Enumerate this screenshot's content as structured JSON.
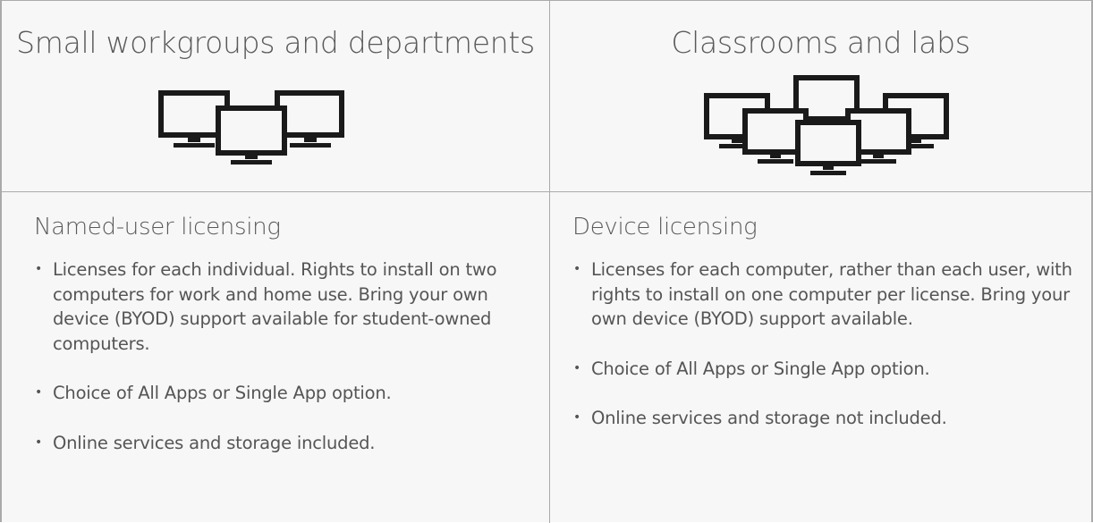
{
  "columns": [
    {
      "heading": "Small workgroups and departments",
      "icon": "computer-group-icon",
      "subheading": "Named-user licensing",
      "bullets": [
        "Licenses for each individual. Rights to install on two computers for work and home use. Bring your own device (BYOD) support available for student-owned computers.",
        "Choice of All Apps or Single App option.",
        "Online services and storage included."
      ]
    },
    {
      "heading": "Classrooms and labs",
      "icon": "computer-lab-icon",
      "subheading": "Device licensing",
      "bullets": [
        "Licenses for each computer, rather than each user, with rights to install on one computer per license. Bring your own device (BYOD) support available.",
        "Choice of All Apps or Single App option.",
        "Online services and storage not included."
      ]
    }
  ],
  "bullet_glyph": "•",
  "colors": {
    "panel_background": "#f7f7f7",
    "border": "#aaaaaa",
    "text": "#555555",
    "icon": "#1a1a1a"
  }
}
